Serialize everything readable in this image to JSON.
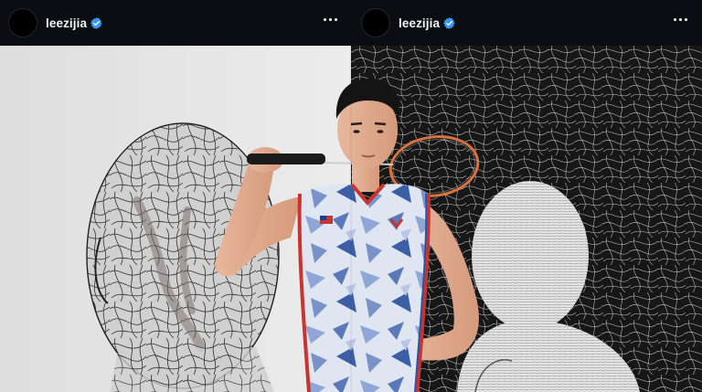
{
  "posts": [
    {
      "username": "leezijia",
      "verified": true
    },
    {
      "username": "leezijia",
      "verified": true
    }
  ],
  "icons": {
    "verified": "verified-badge-icon",
    "more": "more-options-icon"
  },
  "colors": {
    "header_bg": "#0b0d12",
    "verified_blue": "#3897f0",
    "jersey_red": "#c8342f",
    "jersey_blue": "#2a55a5"
  }
}
